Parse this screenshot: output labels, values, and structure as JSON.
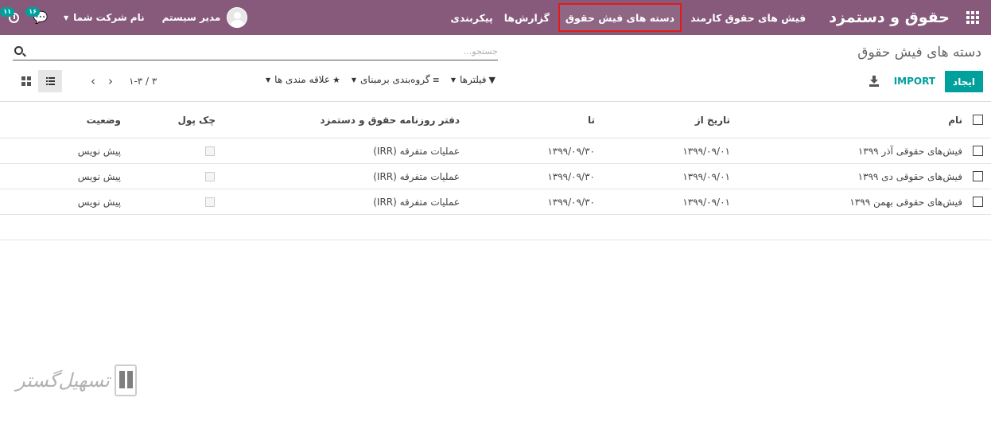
{
  "navbar": {
    "brand": "حقوق و دستمزد",
    "menu": [
      {
        "label": "فیش های حقوق کارمند",
        "active": false
      },
      {
        "label": "دسته های فیش حقوق",
        "active": true
      },
      {
        "label": "گزارش‌ها",
        "active": false
      },
      {
        "label": "پیکربندی",
        "active": false
      }
    ],
    "user_name": "مدیر سیستم",
    "company_name": "نام شرکت شما",
    "chat_badge": "۱۶",
    "activity_badge": "۱۱"
  },
  "control_panel": {
    "title": "دسته های فیش حقوق",
    "search_placeholder": "جستجو...",
    "create_label": "ایجاد",
    "import_label": "IMPORT",
    "filters_label": "فیلترها",
    "group_by_label": "گروه‌بندی برمبنای",
    "favorites_label": "علاقه مندی ها",
    "pager_value": "۱-۳ / ۳"
  },
  "table": {
    "columns": [
      "نام",
      "تاریخ از",
      "تا",
      "دفتر روزنامه حقوق و دستمزد",
      "چک پول",
      "وضعیت"
    ],
    "rows": [
      {
        "name": "فیش‌های حقوقی آذر ۱۳۹۹",
        "date_from": "۱۳۹۹/۰۹/۰۱",
        "date_to": "۱۳۹۹/۰۹/۳۰",
        "journal": "عملیات متفرقه (IRR)",
        "credit_note": false,
        "state": "پیش نویس"
      },
      {
        "name": "فیش‌های حقوقی دی ۱۳۹۹",
        "date_from": "۱۳۹۹/۰۹/۰۱",
        "date_to": "۱۳۹۹/۰۹/۳۰",
        "journal": "عملیات متفرقه (IRR)",
        "credit_note": false,
        "state": "پیش نویس"
      },
      {
        "name": "فیش‌های حقوقی بهمن ۱۳۹۹",
        "date_from": "۱۳۹۹/۰۹/۰۱",
        "date_to": "۱۳۹۹/۰۹/۳۰",
        "journal": "عملیات متفرقه (IRR)",
        "credit_note": false,
        "state": "پیش نویس"
      }
    ]
  },
  "watermark": {
    "text": "تسهیل‌گستر"
  },
  "colors": {
    "navbar": "#875a7b",
    "accent": "#00a09d",
    "highlight": "#e01b1b"
  }
}
